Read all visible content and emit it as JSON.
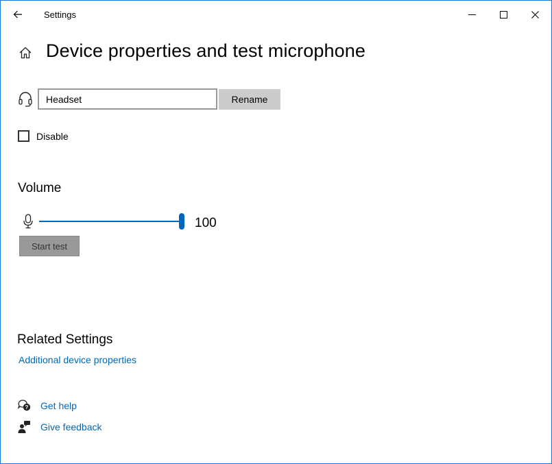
{
  "window": {
    "app_title": "Settings",
    "border_color": "#1976d2",
    "controls": {
      "minimize": "minimize-icon",
      "maximize": "maximize-icon",
      "close": "close-icon"
    }
  },
  "header": {
    "back_icon": "back-arrow-icon",
    "home_icon": "home-icon",
    "title": "Device properties and test microphone"
  },
  "device": {
    "icon": "headset-icon",
    "name_value": "Headset",
    "rename_label": "Rename"
  },
  "disable": {
    "label": "Disable",
    "checked": false
  },
  "volume": {
    "heading": "Volume",
    "icon": "microphone-icon",
    "value": "100",
    "level_percent": 100,
    "accent_color": "#0067c0",
    "start_test_label": "Start test"
  },
  "related": {
    "heading": "Related Settings",
    "additional_link": "Additional device properties",
    "link_color": "#0067b8"
  },
  "support": {
    "help_icon": "chat-help-icon",
    "help_label": "Get help",
    "feedback_icon": "feedback-icon",
    "feedback_label": "Give feedback"
  }
}
